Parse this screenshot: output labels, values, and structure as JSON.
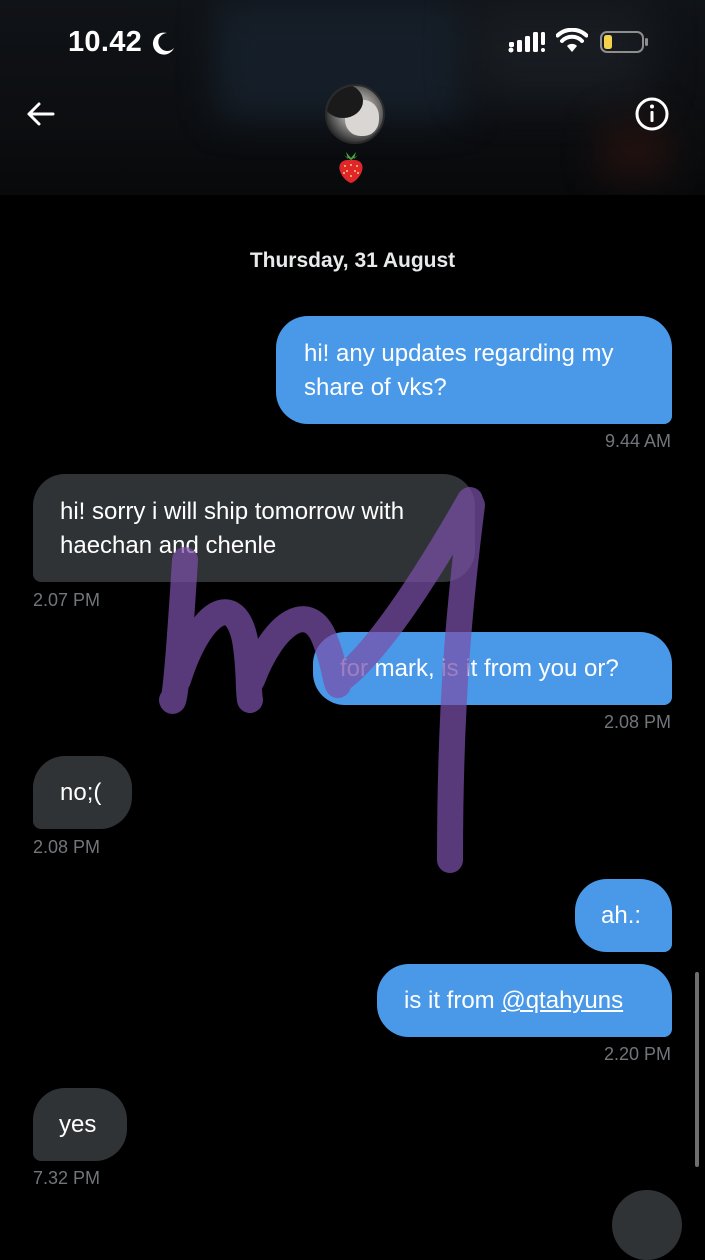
{
  "status_bar": {
    "time": "10.42"
  },
  "header": {
    "contact_emoji": "🍓"
  },
  "date_divider": "Thursday, 31 August",
  "messages": [
    {
      "direction": "sent",
      "text": "hi! any updates regarding my share of vks?",
      "time": "9.44 AM"
    },
    {
      "direction": "received",
      "text": "hi! sorry i will ship tomorrow with haechan and chenle",
      "time": "2.07 PM"
    },
    {
      "direction": "sent",
      "text": "for mark, is it from you or?",
      "time": "2.08 PM"
    },
    {
      "direction": "received",
      "text": "no;(",
      "time": "2.08 PM"
    },
    {
      "direction": "sent",
      "text": "ah.:",
      "time": ""
    },
    {
      "direction": "sent",
      "text_prefix": "is it from ",
      "mention": "@qtahyuns",
      "time": "2.20 PM"
    },
    {
      "direction": "received",
      "text": "yes",
      "time": "7.32 PM"
    }
  ],
  "colors": {
    "sent_bubble": "#4a99e9",
    "received_bubble": "#2f3336",
    "timestamp": "#71767b",
    "background": "#000000"
  },
  "icons": [
    "moon-icon",
    "cellular-signal-icon",
    "wifi-icon",
    "battery-icon",
    "back-arrow-icon",
    "info-icon",
    "strawberry-emoji"
  ]
}
